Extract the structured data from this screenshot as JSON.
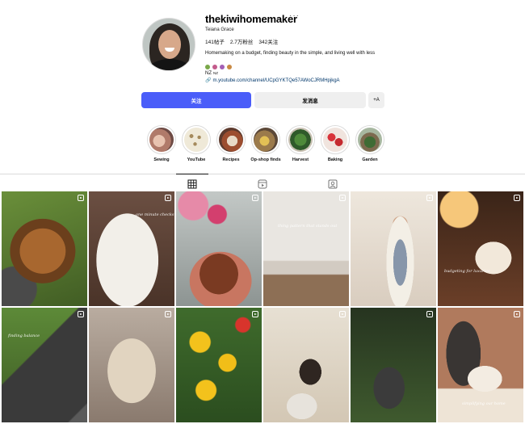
{
  "profile": {
    "username": "thekiwihomemaker",
    "full_name": "Teiana Grace",
    "posts": "141帖子",
    "followers": "2.7万粉丝",
    "following": "342关注",
    "bio_line1": "Homemaking on a budget, finding beauty in the simple, and living well with less",
    "bio_location": "NZ",
    "bio_location_suffix": "NZ",
    "link": "m.youtube.com/channel/UCpGYKTQe57AWoCJRMHpjkgA"
  },
  "buttons": {
    "follow": "关注",
    "message": "发消息",
    "suggest": "+A"
  },
  "highlights": [
    {
      "label": "Sewing"
    },
    {
      "label": "YouTube"
    },
    {
      "label": "Recipes"
    },
    {
      "label": "Op-shop finds"
    },
    {
      "label": "Harvest"
    },
    {
      "label": "Baking"
    },
    {
      "label": "Garden"
    }
  ],
  "tabs": [
    "posts-grid-icon",
    "reels-icon",
    "tagged-icon"
  ],
  "posts": [
    {
      "icon": "reel-icon",
      "overlay": ""
    },
    {
      "icon": "reel-icon",
      "overlay": "one minute checks"
    },
    {
      "icon": "reel-icon",
      "overlay": ""
    },
    {
      "icon": "reel-icon",
      "overlay": "thing pattern that stands out"
    },
    {
      "icon": "reel-icon",
      "overlay": ""
    },
    {
      "icon": "reel-icon",
      "overlay": "budgeting for luxuries"
    },
    {
      "icon": "reel-icon",
      "overlay": "finding balance"
    },
    {
      "icon": "reel-icon",
      "overlay": ""
    },
    {
      "icon": "reel-icon",
      "overlay": ""
    },
    {
      "icon": "reel-icon",
      "overlay": ""
    },
    {
      "icon": "reel-icon",
      "overlay": ""
    },
    {
      "icon": "reel-icon",
      "overlay": "simplifying our home"
    }
  ],
  "colors": {
    "follow_button": "#4a5df9",
    "link": "#00376b",
    "secondary_button": "#efefef"
  }
}
